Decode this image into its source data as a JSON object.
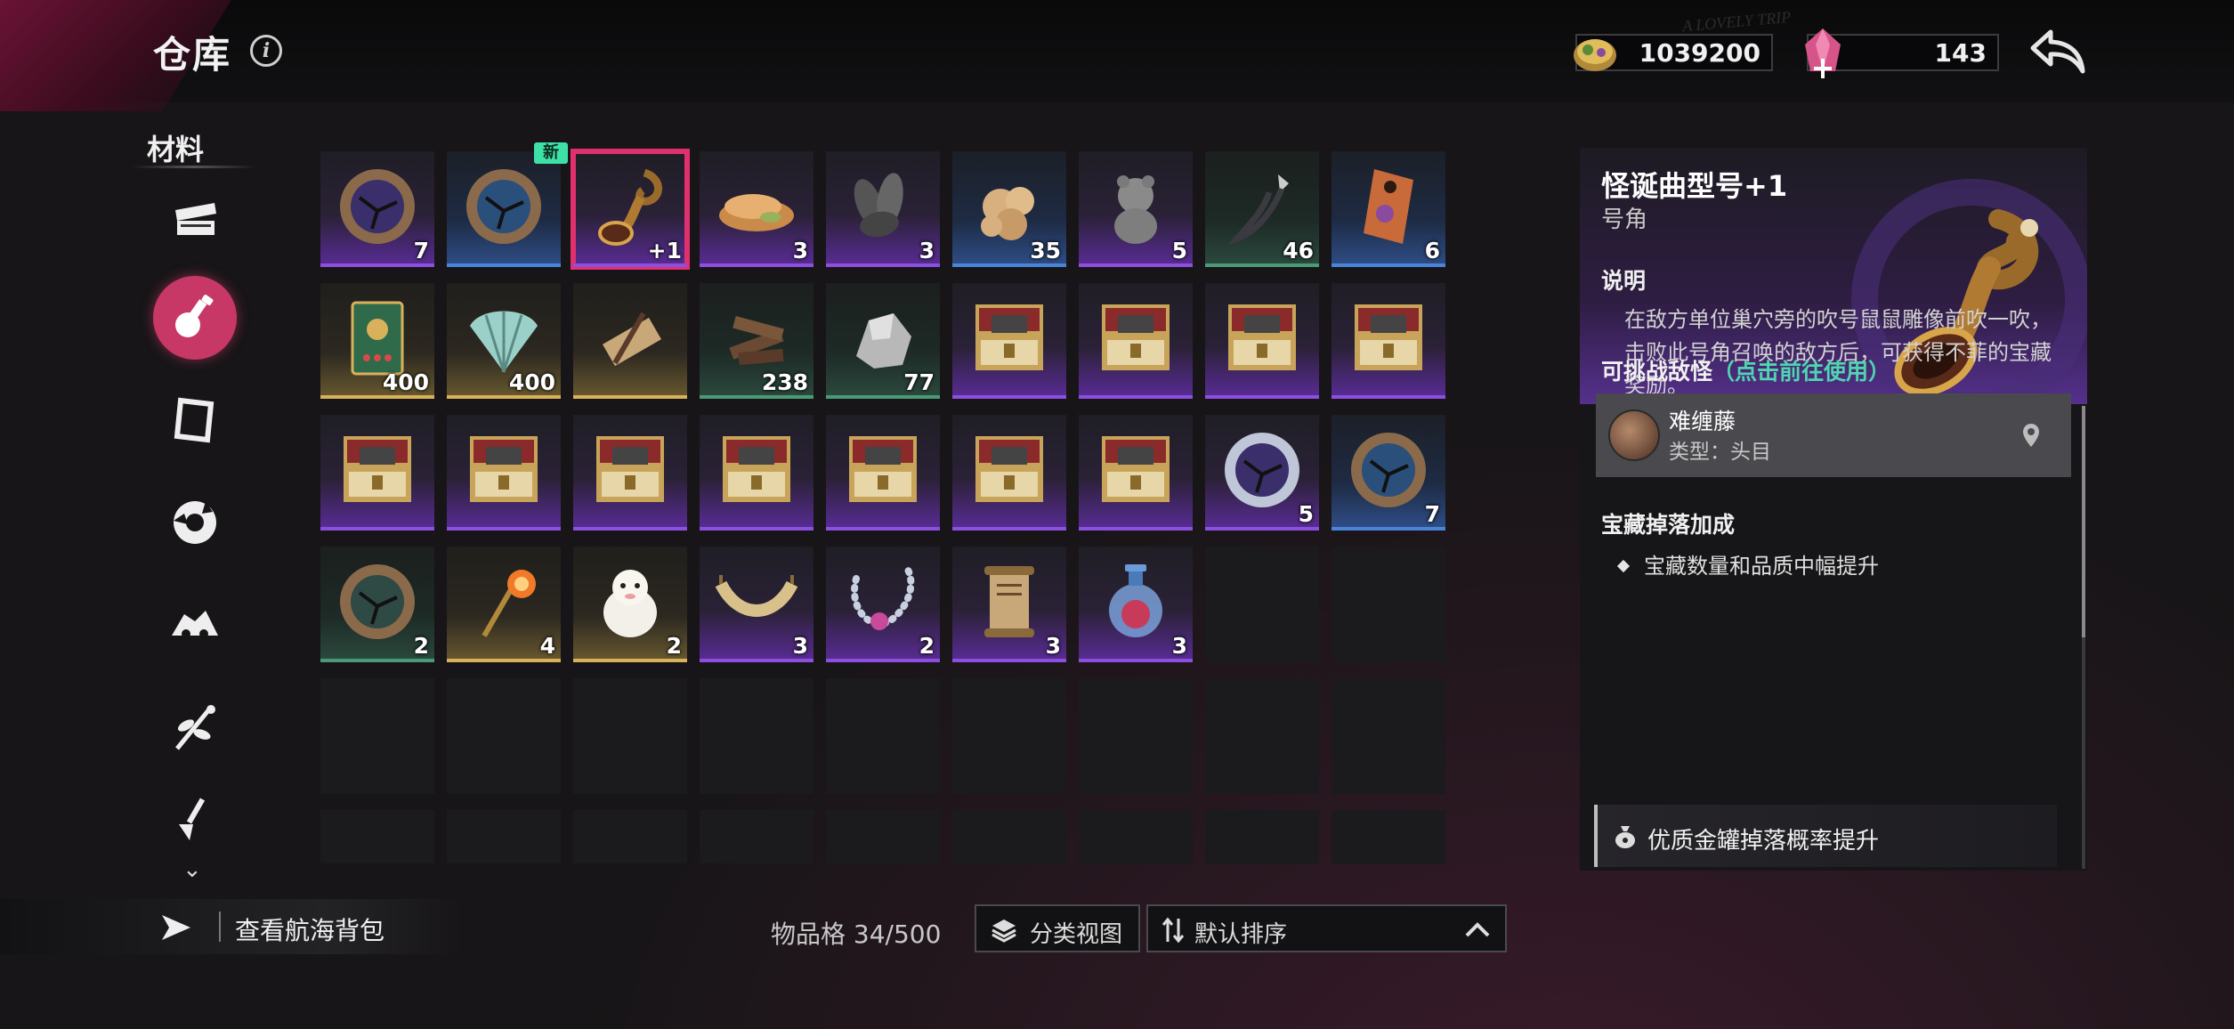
{
  "header": {
    "title": "仓库",
    "info_icon": "i",
    "watermark": "A LOVELY TRIP",
    "currencies": [
      {
        "name": "gold-coin",
        "value": "1039200"
      },
      {
        "name": "pink-crystal",
        "value": "143"
      }
    ]
  },
  "sidebar": {
    "category_label": "材料",
    "items": [
      {
        "icon": "chest-icon",
        "active": false
      },
      {
        "icon": "bottle-icon",
        "active": true
      },
      {
        "icon": "scroll-map-icon",
        "active": false
      },
      {
        "icon": "gear-part-icon",
        "active": false
      },
      {
        "icon": "ship-part-icon",
        "active": false
      },
      {
        "icon": "herb-icon",
        "active": false
      },
      {
        "icon": "shovel-icon",
        "active": false
      }
    ]
  },
  "inventory": {
    "rows": [
      [
        {
          "icon": "cracked-medallion-dark",
          "rarity": "purple",
          "count": "7"
        },
        {
          "icon": "cracked-medallion-blue",
          "rarity": "blue",
          "count": "",
          "new": "新"
        },
        {
          "icon": "horn-serpent",
          "rarity": "purple",
          "count": "+1",
          "selected": true
        },
        {
          "icon": "bread-plate",
          "rarity": "purple",
          "count": "3"
        },
        {
          "icon": "seeds",
          "rarity": "purple",
          "count": "3"
        },
        {
          "icon": "ginger-root",
          "rarity": "blue",
          "count": "35"
        },
        {
          "icon": "stone-bear",
          "rarity": "purple",
          "count": "5"
        },
        {
          "icon": "iron-hook",
          "rarity": "green",
          "count": "46"
        },
        {
          "icon": "door-tag",
          "rarity": "blue",
          "count": "6"
        }
      ],
      [
        {
          "icon": "card-map",
          "rarity": "gold",
          "count": "400"
        },
        {
          "icon": "seashell",
          "rarity": "gold",
          "count": "400"
        },
        {
          "icon": "scroll-roll",
          "rarity": "gold",
          "count": ""
        },
        {
          "icon": "wood-logs",
          "rarity": "green",
          "count": "238"
        },
        {
          "icon": "stone-ore",
          "rarity": "green",
          "count": "77"
        },
        {
          "icon": "treasure-chest",
          "rarity": "purple",
          "count": ""
        },
        {
          "icon": "treasure-chest",
          "rarity": "purple",
          "count": ""
        },
        {
          "icon": "treasure-chest",
          "rarity": "purple",
          "count": ""
        },
        {
          "icon": "treasure-chest",
          "rarity": "purple",
          "count": ""
        }
      ],
      [
        {
          "icon": "treasure-chest",
          "rarity": "purple",
          "count": ""
        },
        {
          "icon": "treasure-chest",
          "rarity": "purple",
          "count": ""
        },
        {
          "icon": "treasure-chest",
          "rarity": "purple",
          "count": ""
        },
        {
          "icon": "treasure-chest",
          "rarity": "purple",
          "count": ""
        },
        {
          "icon": "treasure-chest",
          "rarity": "purple",
          "count": ""
        },
        {
          "icon": "treasure-chest",
          "rarity": "purple",
          "count": ""
        },
        {
          "icon": "treasure-chest",
          "rarity": "purple",
          "count": ""
        },
        {
          "icon": "cracked-medallion-saw",
          "rarity": "purple",
          "count": "5"
        },
        {
          "icon": "cracked-medallion-blue",
          "rarity": "blue",
          "count": "7"
        }
      ],
      [
        {
          "icon": "cracked-medallion-green",
          "rarity": "green",
          "count": "2"
        },
        {
          "icon": "golden-staff",
          "rarity": "gold",
          "count": "4"
        },
        {
          "icon": "white-lamb",
          "rarity": "gold",
          "count": "2"
        },
        {
          "icon": "hammock",
          "rarity": "purple",
          "count": "3"
        },
        {
          "icon": "pearl-necklace",
          "rarity": "purple",
          "count": "2"
        },
        {
          "icon": "ancient-scroll",
          "rarity": "purple",
          "count": "3"
        },
        {
          "icon": "potion-bottle",
          "rarity": "purple",
          "count": "3"
        },
        {
          "icon": "",
          "rarity": "empty",
          "count": ""
        },
        {
          "icon": "",
          "rarity": "empty",
          "count": ""
        }
      ]
    ]
  },
  "footer": {
    "bag_label": "查看航海背包",
    "capacity": "物品格 34/500",
    "view_button": "分类视图",
    "sort_button": "默认排序"
  },
  "detail": {
    "name": "怪诞曲型号+1",
    "type": "号角",
    "desc_title": "说明",
    "description": "在敌方单位巢穴旁的吹号鼠鼠雕像前吹一吹，击败此号角召唤的敌方后，可获得不菲的宝藏奖励。",
    "challenge_title": "可挑战敌怪",
    "challenge_link": "（点击前往使用）",
    "boss": {
      "name": "难缠藤",
      "type": "类型：头目"
    },
    "bonus_title": "宝藏掉落加成",
    "bonus_item": "宝藏数量和品质中幅提升",
    "perk": "优质金罐掉落概率提升"
  },
  "colors": {
    "accent": "#c73867",
    "selected_outline": "#e0306e",
    "new_badge": "#3ee0a8",
    "link": "#4fd6b0",
    "rarity_purple": "#8c4fe0",
    "rarity_blue": "#4a84d8",
    "rarity_green": "#4a9a78",
    "rarity_gold": "#d8b15a"
  }
}
